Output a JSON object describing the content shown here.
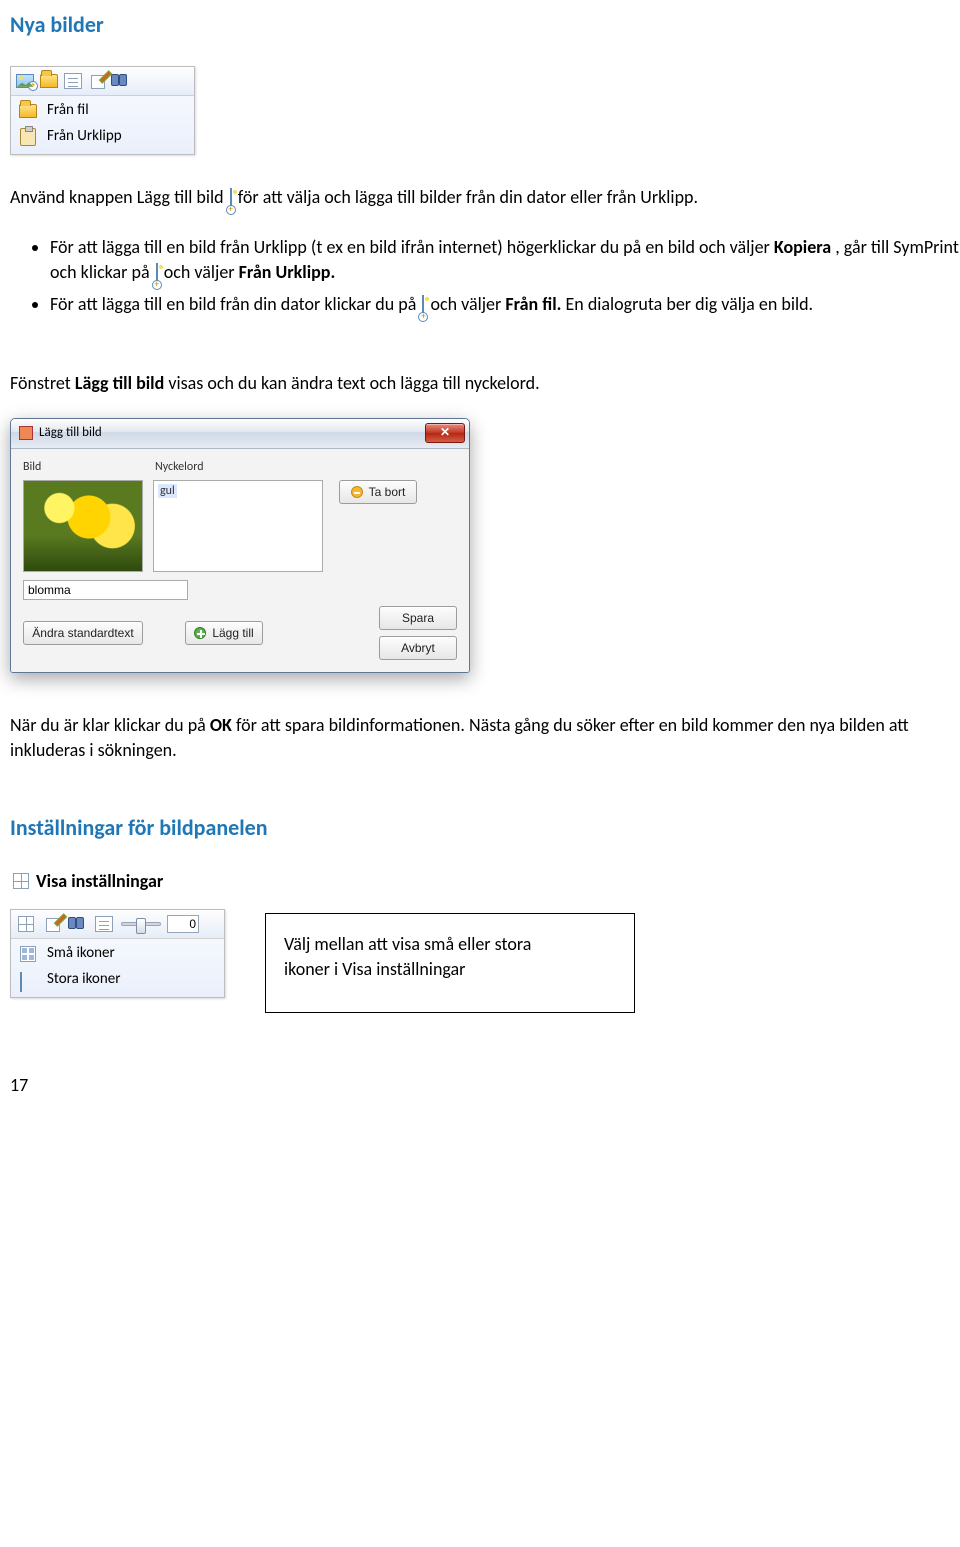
{
  "section1_heading": "Nya bilder",
  "toolbar1": {
    "from_file": "Från fil",
    "from_clipboard": "Från Urklipp"
  },
  "para1_a": "Använd knappen Lägg till bild ",
  "para1_b": "för att välja och lägga till bilder från din dator eller från Urklipp.",
  "bullets": {
    "b1_a": "För att lägga till en bild från Urklipp (t ex en bild ifrån internet) högerklickar du på en bild och väljer ",
    "b1_kopiera": "Kopiera",
    "b1_b": ", går till SymPrint och klickar på ",
    "b1_c": "och väljer ",
    "b1_urklipp": "Från Urklipp.",
    "b2_a": "För att lägga till en bild från din dator klickar du på ",
    "b2_b": "och väljer ",
    "b2_fil": "Från fil.",
    "b2_c": " En dialogruta ber dig välja en bild."
  },
  "para2_a": "Fönstret ",
  "para2_b": "Lägg till bild",
  "para2_c": " visas och du kan ändra text och lägga till nyckelord.",
  "dialog": {
    "title": "Lägg till bild",
    "label_bild": "Bild",
    "label_keyword": "Nyckelord",
    "keyword_value": "gul",
    "remove": "Ta bort",
    "textfield_value": "blomma",
    "change_default": "Ändra standardtext",
    "add": "Lägg till",
    "save": "Spara",
    "cancel": "Avbryt"
  },
  "para3_a": "När du är klar klickar du på ",
  "para3_ok": "OK",
  "para3_b": " för att spara bildinformationen. Nästa gång du söker efter en bild kommer den nya bilden att inkluderas i sökningen.",
  "section2_heading": "Inställningar för bildpanelen",
  "sub_heading": "Visa inställningar",
  "toolbar2": {
    "slider_value": "0",
    "small_icons": "Små ikoner",
    "large_icons": "Stora ikoner"
  },
  "info_box_line1": "Välj mellan att visa små eller stora",
  "info_box_line2": "ikoner i Visa inställningar",
  "page_number": "17"
}
